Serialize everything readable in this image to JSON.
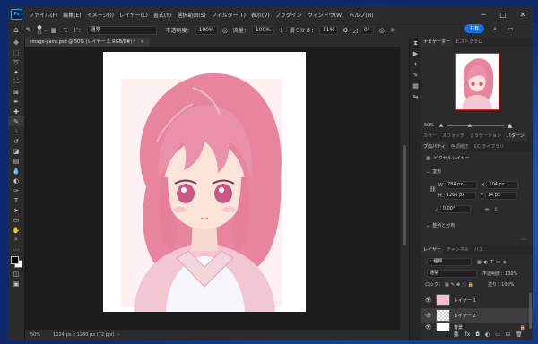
{
  "app": {
    "logo": "Ps"
  },
  "menu": [
    "ファイル(F)",
    "編集(E)",
    "イメージ(I)",
    "レイヤー(L)",
    "書式(Y)",
    "選択範囲(S)",
    "フィルター(T)",
    "表示(V)",
    "プラグイン",
    "ウィンドウ(W)",
    "ヘルプ(H)"
  ],
  "options": {
    "brush_size": "11",
    "mode_label": "モード：",
    "mode_value": "通常",
    "opacity_label": "不透明度：",
    "opacity_value": "100%",
    "flow_label": "流量：",
    "flow_value": "100%",
    "smoothing_label": "滑らかさ：",
    "smoothing_value": "11%",
    "angle_value": "0°",
    "share_label": "共有"
  },
  "document": {
    "tab_title": "image-paint.psd @ 50% (レイヤー 2, RGB/8#) *"
  },
  "status": {
    "zoom": "50%",
    "doc_info": "1024 px x 1280 px (72 ppi)"
  },
  "navigator": {
    "tabs": [
      "ナビゲーター",
      "ヒストグラム"
    ],
    "zoom": "50%"
  },
  "color_tabs": [
    "カラー",
    "スウォッチ",
    "グラデーション",
    "パターン"
  ],
  "props": {
    "tabs": [
      "プロパティ",
      "色調補正",
      "CC ライブラリ"
    ],
    "layer_type": "ピクセルレイヤー",
    "transform_header": "変形",
    "w_label": "W",
    "w_value": "784 px",
    "x_label": "X",
    "x_value": "104 px",
    "h_label": "H",
    "h_value": "1266 px",
    "y_label": "Y",
    "y_value": "14 px",
    "angle_value": "0.00°",
    "align_header": "整列と分布"
  },
  "layers": {
    "tabs": [
      "レイヤー",
      "チャンネル",
      "パス"
    ],
    "filter_label": "種類",
    "blend_mode": "通常",
    "opacity_label": "不透明度：",
    "opacity_value": "100%",
    "lock_label": "ロック：",
    "fill_label": "塗り：",
    "fill_value": "100%",
    "items": [
      {
        "name": "レイヤー 1",
        "selected": false
      },
      {
        "name": "レイヤー 2",
        "selected": true
      },
      {
        "name": "背景",
        "selected": false
      }
    ]
  },
  "colors": {
    "accent": "#1473e6",
    "selection_box": "#e6302e"
  }
}
